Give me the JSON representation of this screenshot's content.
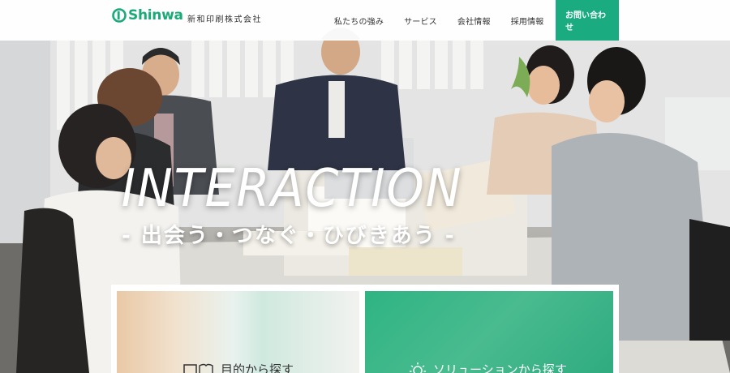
{
  "header": {
    "logo_text": "Shinwa",
    "company_name": "新和印刷株式会社",
    "nav": [
      {
        "label": "私たちの強み"
      },
      {
        "label": "サービス"
      },
      {
        "label": "会社情報"
      },
      {
        "label": "採用情報"
      }
    ],
    "cta_label": "お問い合わせ"
  },
  "hero": {
    "headline": "INTERACTION",
    "subline": "- 出会う・つなぐ・ひびきあう -"
  },
  "cards": [
    {
      "label": "目的から探す",
      "icon": "book-icon"
    },
    {
      "label": "ソリューションから探す",
      "icon": "lightbulb-icon"
    }
  ],
  "colors": {
    "brand": "#1aab80",
    "header_bg": "#ffffff"
  }
}
